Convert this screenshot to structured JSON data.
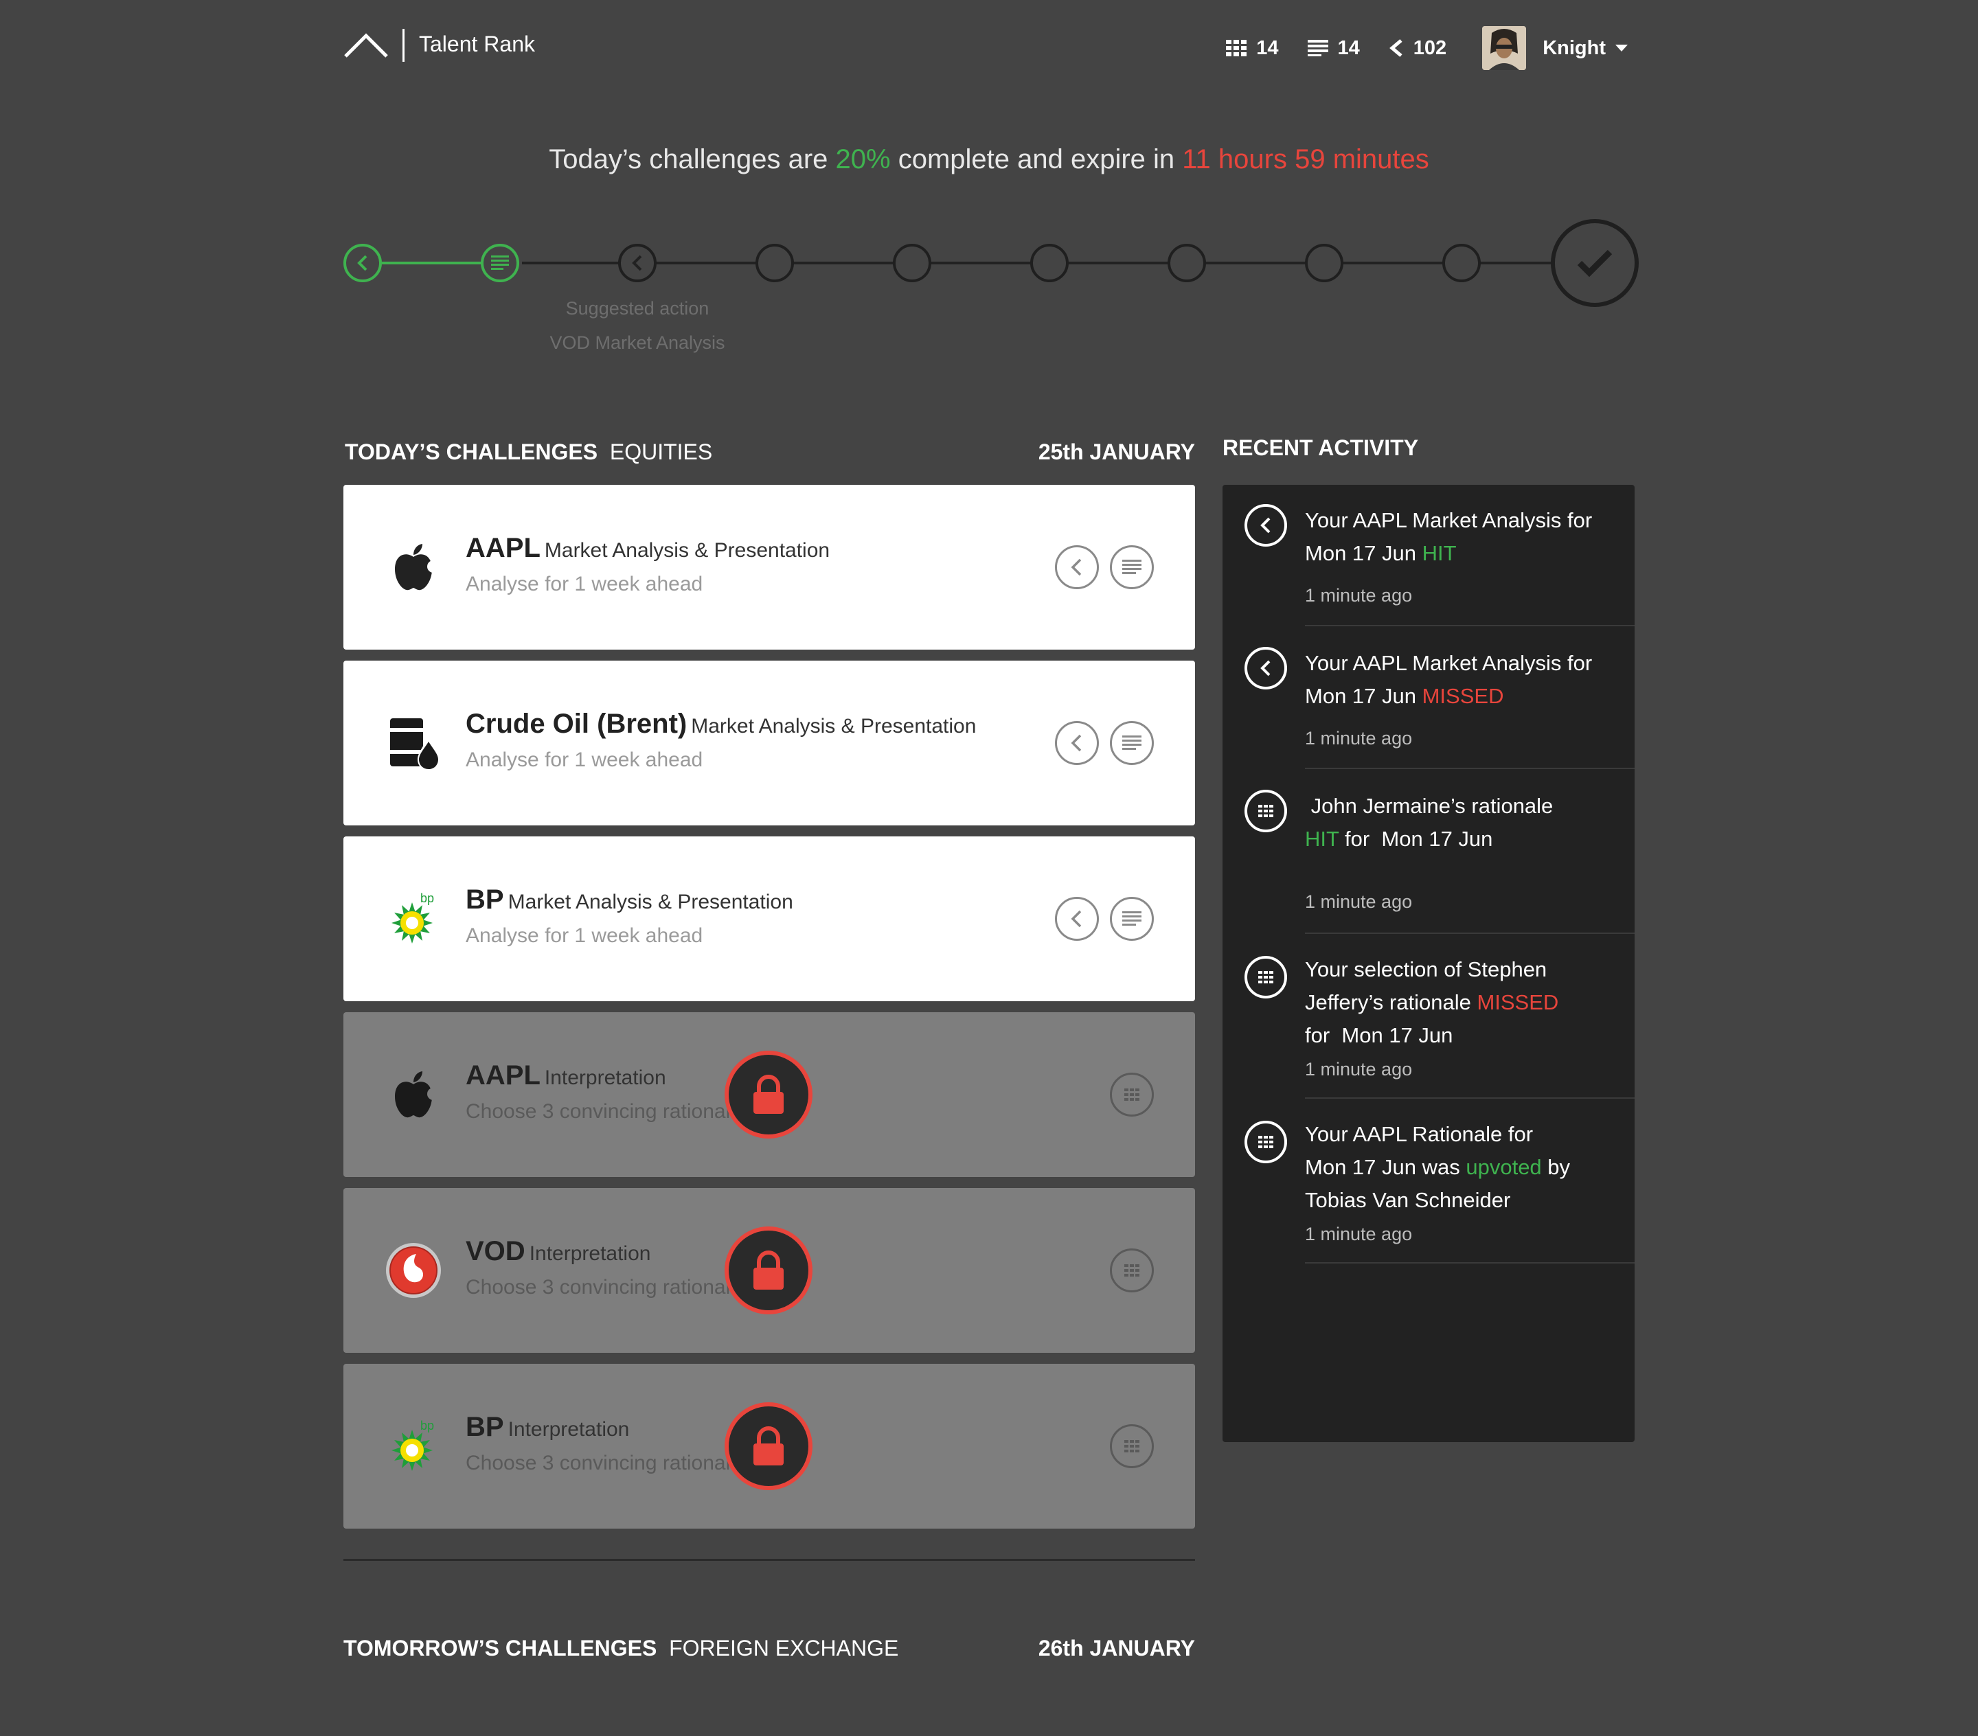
{
  "app": {
    "title": "Talent Rank"
  },
  "header": {
    "stats": [
      {
        "icon": "grid-icon",
        "value": "14"
      },
      {
        "icon": "list-icon",
        "value": "14"
      },
      {
        "icon": "share-icon",
        "value": "102"
      }
    ],
    "user": {
      "name": "Knight"
    }
  },
  "status": {
    "prefix": "Today’s challenges are ",
    "percent": "20%",
    "middle": " complete and expire in ",
    "expiry": "11 hours 59 minutes"
  },
  "progress": {
    "completed_steps": 2,
    "total_steps": 10,
    "suggested_label": "Suggested action",
    "suggested_item": "VOD Market Analysis"
  },
  "today": {
    "title_bold": "TODAY’S CHALLENGES",
    "title_light": "EQUITIES",
    "date": "25th JANUARY",
    "cards": [
      {
        "logo": "apple-logo",
        "ticker": "AAPL",
        "task": "Market Analysis & Presentation",
        "sub": "Analyse for 1 week ahead",
        "locked": false
      },
      {
        "logo": "oil-barrel-logo",
        "ticker": "Crude Oil (Brent)",
        "task": "Market Analysis & Presentation",
        "sub": "Analyse for 1 week ahead",
        "locked": false
      },
      {
        "logo": "bp-logo",
        "ticker": "BP",
        "task": "Market Analysis & Presentation",
        "sub": "Analyse for 1 week ahead",
        "locked": false
      },
      {
        "logo": "apple-logo",
        "ticker": "AAPL",
        "task": "Interpretation",
        "sub": "Choose 3 convincing rationales",
        "locked": true
      },
      {
        "logo": "vodafone-logo",
        "ticker": "VOD",
        "task": "Interpretation",
        "sub": "Choose 3 convincing rationales",
        "locked": true
      },
      {
        "logo": "bp-logo",
        "ticker": "BP",
        "task": "Interpretation",
        "sub": "Choose 3 convincing rationales",
        "locked": true
      }
    ]
  },
  "tomorrow": {
    "title_bold": "TOMORROW’S CHALLENGES",
    "title_light": "FOREIGN EXCHANGE",
    "date": "26th JANUARY"
  },
  "activity": {
    "title": "RECENT ACTIVITY",
    "items": [
      {
        "icon": "share-icon",
        "line1": "Your AAPL Market Analysis for",
        "line2_a": "Mon 17 Jun ",
        "line2_status": "HIT",
        "time": "1 minute ago"
      },
      {
        "icon": "share-icon",
        "line1": "Your AAPL Market Analysis for",
        "line2_a": "Mon 17 Jun ",
        "line2_status": "MISSED",
        "time": "1 minute ago"
      },
      {
        "icon": "grid-icon",
        "line1": " John Jermaine’s rationale",
        "line2_status": "HIT",
        "line2_b": " for  Mon 17 Jun",
        "time": "1 minute ago"
      },
      {
        "icon": "grid-icon",
        "line1": "Your selection of Stephen",
        "line2_a": "Jeffery’s rationale ",
        "line2_status": "MISSED",
        "line3": "for  Mon 17 Jun",
        "time": "1 minute ago"
      },
      {
        "icon": "grid-icon",
        "line1": "Your AAPL Rationale for",
        "line2_a": "Mon 17 Jun was ",
        "line2_status": "upvoted",
        "line2_b": " by",
        "line3": "Tobias Van Schneider",
        "time": "1 minute ago"
      }
    ]
  },
  "colors": {
    "accent_green": "#3fb34f",
    "alert_red": "#e8453c",
    "background": "#444444",
    "panel": "#222222"
  }
}
